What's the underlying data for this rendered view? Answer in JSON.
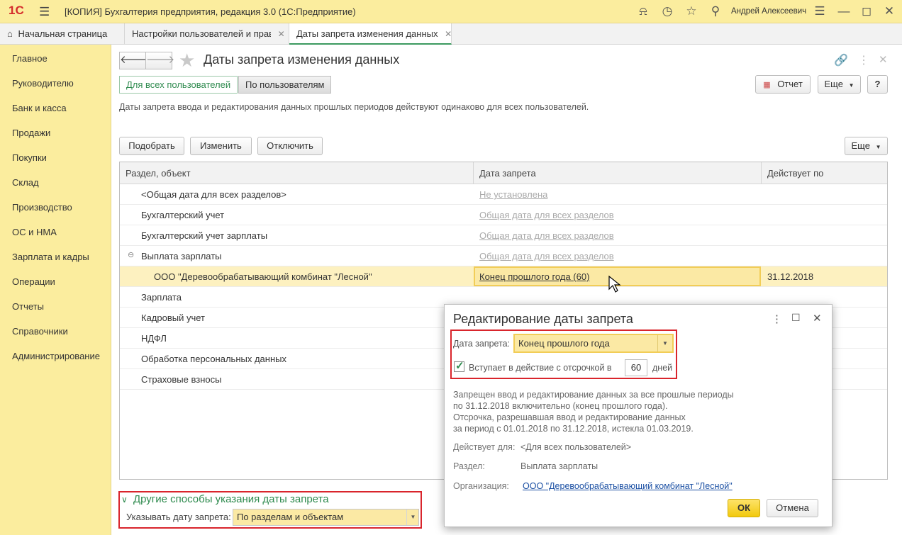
{
  "titlebar": {
    "logo": "1С",
    "title": "[КОПИЯ] Бухгалтерия предприятия, редакция 3.0  (1С:Предприятие)",
    "user": "Андрей Алексеевич"
  },
  "tabs": [
    {
      "label": "Начальная страница"
    },
    {
      "label": "Настройки пользователей и прав"
    },
    {
      "label": "Даты запрета изменения данных"
    }
  ],
  "sidebar": {
    "items": [
      {
        "label": "Главное"
      },
      {
        "label": "Руководителю"
      },
      {
        "label": "Банк и касса"
      },
      {
        "label": "Продажи"
      },
      {
        "label": "Покупки"
      },
      {
        "label": "Склад"
      },
      {
        "label": "Производство"
      },
      {
        "label": "ОС и НМА"
      },
      {
        "label": "Зарплата и кадры"
      },
      {
        "label": "Операции"
      },
      {
        "label": "Отчеты"
      },
      {
        "label": "Справочники"
      },
      {
        "label": "Администрирование"
      }
    ]
  },
  "form": {
    "title": "Даты запрета изменения данных",
    "toggle_all": "Для всех пользователей",
    "toggle_per_user": "По пользователям",
    "report_label": "Отчет",
    "more_label": "Еще",
    "help_label": "?",
    "info_text": "Даты запрета ввода и редактирования данных прошлых периодов действуют одинаково для всех пользователей."
  },
  "toolbar": {
    "pick_label": "Подобрать",
    "change_label": "Изменить",
    "disable_label": "Отключить",
    "more_label": "Еще"
  },
  "table": {
    "columns": [
      "Раздел, объект",
      "Дата запрета",
      "Действует по"
    ],
    "rows": [
      {
        "section": "<Общая дата для всех разделов>",
        "date": "Не установлена",
        "valid": ""
      },
      {
        "section": "Бухгалтерский учет",
        "date": "Общая дата для всех разделов",
        "valid": ""
      },
      {
        "section": "Бухгалтерский учет зарплаты",
        "date": "Общая дата для всех разделов",
        "valid": ""
      },
      {
        "section": "Выплата зарплаты",
        "date": "Общая дата для всех разделов",
        "valid": ""
      },
      {
        "section": "ООО \"Деревообрабатывающий комбинат \"Лесной\"",
        "date": "Конец прошлого года (60)",
        "valid": "31.12.2018"
      },
      {
        "section": "Зарплата",
        "date": "",
        "valid": ""
      },
      {
        "section": "Кадровый учет",
        "date": "",
        "valid": ""
      },
      {
        "section": "НДФЛ",
        "date": "",
        "valid": ""
      },
      {
        "section": "Обработка персональных данных",
        "date": "",
        "valid": ""
      },
      {
        "section": "Страховые взносы",
        "date": "",
        "valid": ""
      }
    ]
  },
  "bottom": {
    "other_ways": "Другие способы указания даты запрета",
    "specify_label": "Указывать дату запрета:",
    "specify_value": "По разделам и объектам"
  },
  "dialog": {
    "title": "Редактирование даты запрета",
    "date_label": "Дата запрета:",
    "date_value": "Конец прошлого года",
    "delay_label": "Вступает в действие с отсрочкой в",
    "delay_days": "60",
    "days_label": "дней",
    "info_line1": "Запрещен ввод и редактирование данных за все прошлые периоды",
    "info_line2": "по 31.12.2018 включительно (конец прошлого года).",
    "info_line3": "Отсрочка, разрешавшая ввод и редактирование данных",
    "info_line4": "за период с 01.01.2018 по 31.12.2018, истекла 01.03.2019.",
    "valid_for_label": "Действует для:",
    "valid_for_value": "<Для всех пользователей>",
    "section_label": "Раздел:",
    "section_value": "Выплата зарплаты",
    "org_label": "Организация:",
    "org_value": "ООО \"Деревообрабатывающий комбинат \"Лесной\"",
    "ok_label": "ОК",
    "cancel_label": "Отмена"
  },
  "colors": {
    "panel_yellow": "#fbed9e",
    "accent_green": "#2f8b4f",
    "highlight_red": "#d9252c",
    "ok_yellow": "#f6d21f",
    "link_blue": "#1a4fa3"
  }
}
